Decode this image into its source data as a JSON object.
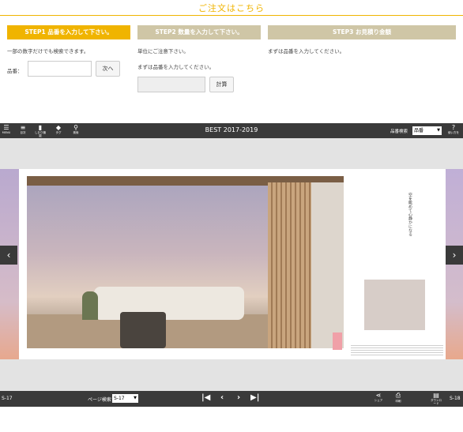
{
  "order": {
    "title": "ご注文はこちら",
    "step1": {
      "label": "STEP1 品番を入力して下さい。",
      "note": "一部の数字だけでも検索できます。",
      "field_label": "品番：",
      "field_value": "",
      "next_button": "次へ",
      "color": "#f0b400"
    },
    "step2": {
      "label": "STEP2 数量を入力して下さい。",
      "note1": "単位にご注意下さい。",
      "note2": "まずは品番を入力してください。",
      "field_value": "",
      "calc_button": "計算",
      "color": "#cfc6a6"
    },
    "step3": {
      "label": "STEP3 お見積り金額",
      "note": "まずは品番を入力してください。",
      "color": "#cfc6a6"
    }
  },
  "viewer": {
    "toolbar": {
      "title": "BEST 2017-2019",
      "icons": [
        {
          "name": "menu-icon",
          "glyph": "☰",
          "label": "MENU"
        },
        {
          "name": "toc-icon",
          "glyph": "≡",
          "label": "目次"
        },
        {
          "name": "bookmark-icon",
          "glyph": "▮",
          "label": "しおり機能"
        },
        {
          "name": "tag-icon",
          "glyph": "◆",
          "label": "タグ"
        },
        {
          "name": "search-icon",
          "glyph": "⚲",
          "label": "検索"
        }
      ],
      "search_label": "品番検索",
      "search_select_value": "品番",
      "help_icon": {
        "name": "help-icon",
        "glyph": "?",
        "label": "使い方を"
      }
    },
    "page_left": "S-17",
    "page_right": "S-18",
    "page_search_label": "ページ検索",
    "page_search_value": "S-17",
    "nav": {
      "first": "|◀",
      "prev": "‹",
      "next": "›",
      "last": "▶|"
    },
    "bottom_icons": [
      {
        "name": "share-icon",
        "glyph": "⋖",
        "label": "シェア"
      },
      {
        "name": "print-icon",
        "glyph": "⎙",
        "label": "印刷"
      },
      {
        "name": "pdf-icon",
        "glyph": "▤",
        "label": "ダウンロード"
      }
    ],
    "arrow_left": "‹",
    "arrow_right": "›",
    "right_page_vertical_text": "空を眺めて心静かになる"
  }
}
